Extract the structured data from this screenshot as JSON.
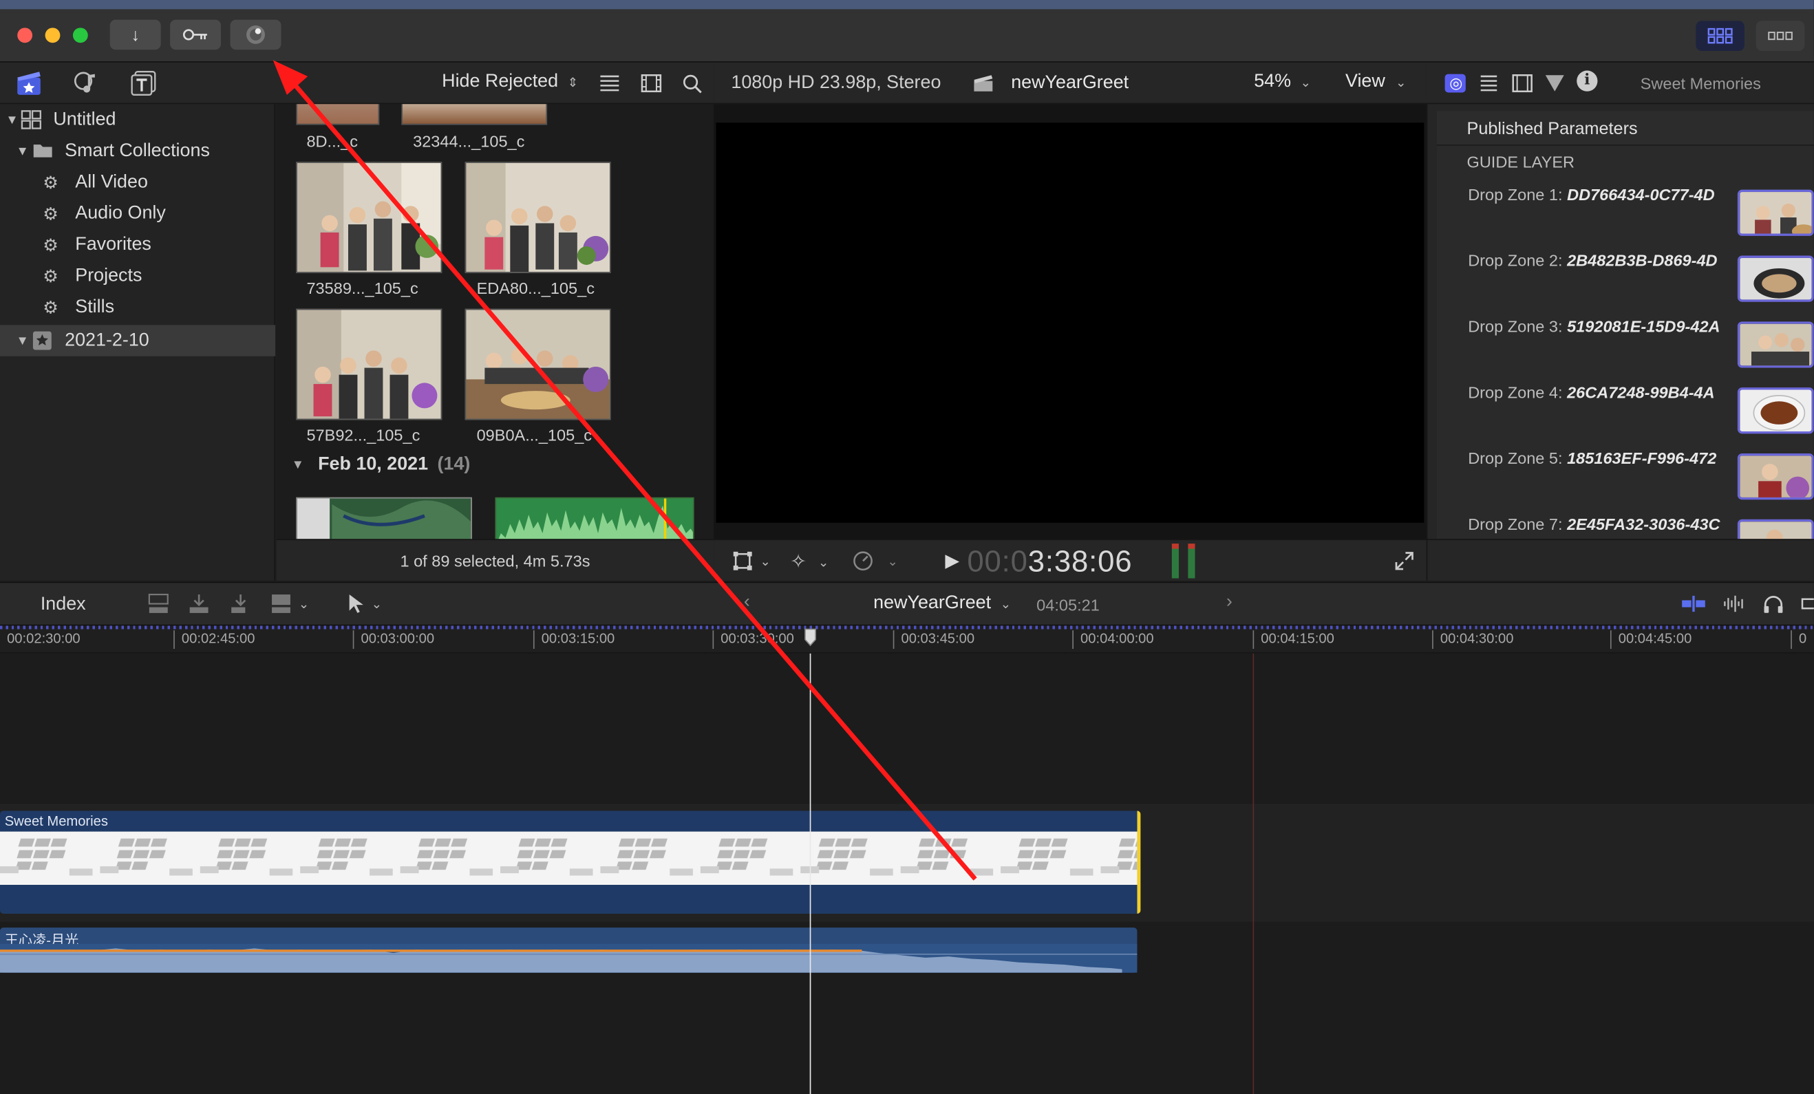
{
  "window_controls": {
    "close_color": "#ff5f57",
    "minimize_color": "#febc2e",
    "zoom_color": "#28c840"
  },
  "toolbar": {
    "import_icon": "download-arrow-icon",
    "keywords_icon": "key-icon",
    "background_tasks_icon": "progress-ring-icon"
  },
  "browser": {
    "filter_label": "Hide Rejected",
    "clips": [
      {
        "name": "8D..._c"
      },
      {
        "name": "32344..._105_c"
      },
      {
        "name": "73589..._105_c"
      },
      {
        "name": "EDA80..._105_c"
      },
      {
        "name": "57B92..._105_c"
      },
      {
        "name": "09B0A..._105_c"
      }
    ],
    "date_group": {
      "label": "Feb 10, 2021",
      "count": "(14)"
    },
    "footer_status": "1 of 89 selected, 4m 5.73s"
  },
  "libraries": {
    "items": [
      {
        "label": "Untitled"
      },
      {
        "label": "Smart Collections"
      },
      {
        "label": "All Video"
      },
      {
        "label": "Audio Only"
      },
      {
        "label": "Favorites"
      },
      {
        "label": "Projects"
      },
      {
        "label": "Stills"
      },
      {
        "label": "2021-2-10"
      }
    ]
  },
  "viewer": {
    "format": "1080p HD 23.98p, Stereo",
    "project_name": "newYearGreet",
    "zoom": "54%",
    "view_label": "View",
    "timecode_dim": "00:0",
    "timecode": "3:38:06"
  },
  "inspector": {
    "title": "Sweet Memories",
    "section": "Published Parameters",
    "group": "GUIDE LAYER",
    "drop_zones": [
      {
        "label": "Drop Zone 1:",
        "value": "DD766434-0C77-4D"
      },
      {
        "label": "Drop Zone 2:",
        "value": "2B482B3B-D869-4D"
      },
      {
        "label": "Drop Zone 3:",
        "value": "5192081E-15D9-42A"
      },
      {
        "label": "Drop Zone 4:",
        "value": "26CA7248-99B4-4A"
      },
      {
        "label": "Drop Zone 5:",
        "value": "185163EF-F996-472"
      },
      {
        "label": "Drop Zone 7:",
        "value": "2E45FA32-3036-43C"
      }
    ]
  },
  "timeline": {
    "index_label": "Index",
    "project_name": "newYearGreet",
    "duration": "04:05:21",
    "ruler_ticks": [
      "00:02:30:00",
      "00:02:45:00",
      "00:03:00:00",
      "00:03:15:00",
      "00:03:30:00",
      "00:03:45:00",
      "00:04:00:00",
      "00:04:15:00",
      "00:04:30:00",
      "00:04:45:00",
      "0"
    ],
    "video_clip": "Sweet Memories",
    "audio_clip": "王心凌-月光"
  }
}
